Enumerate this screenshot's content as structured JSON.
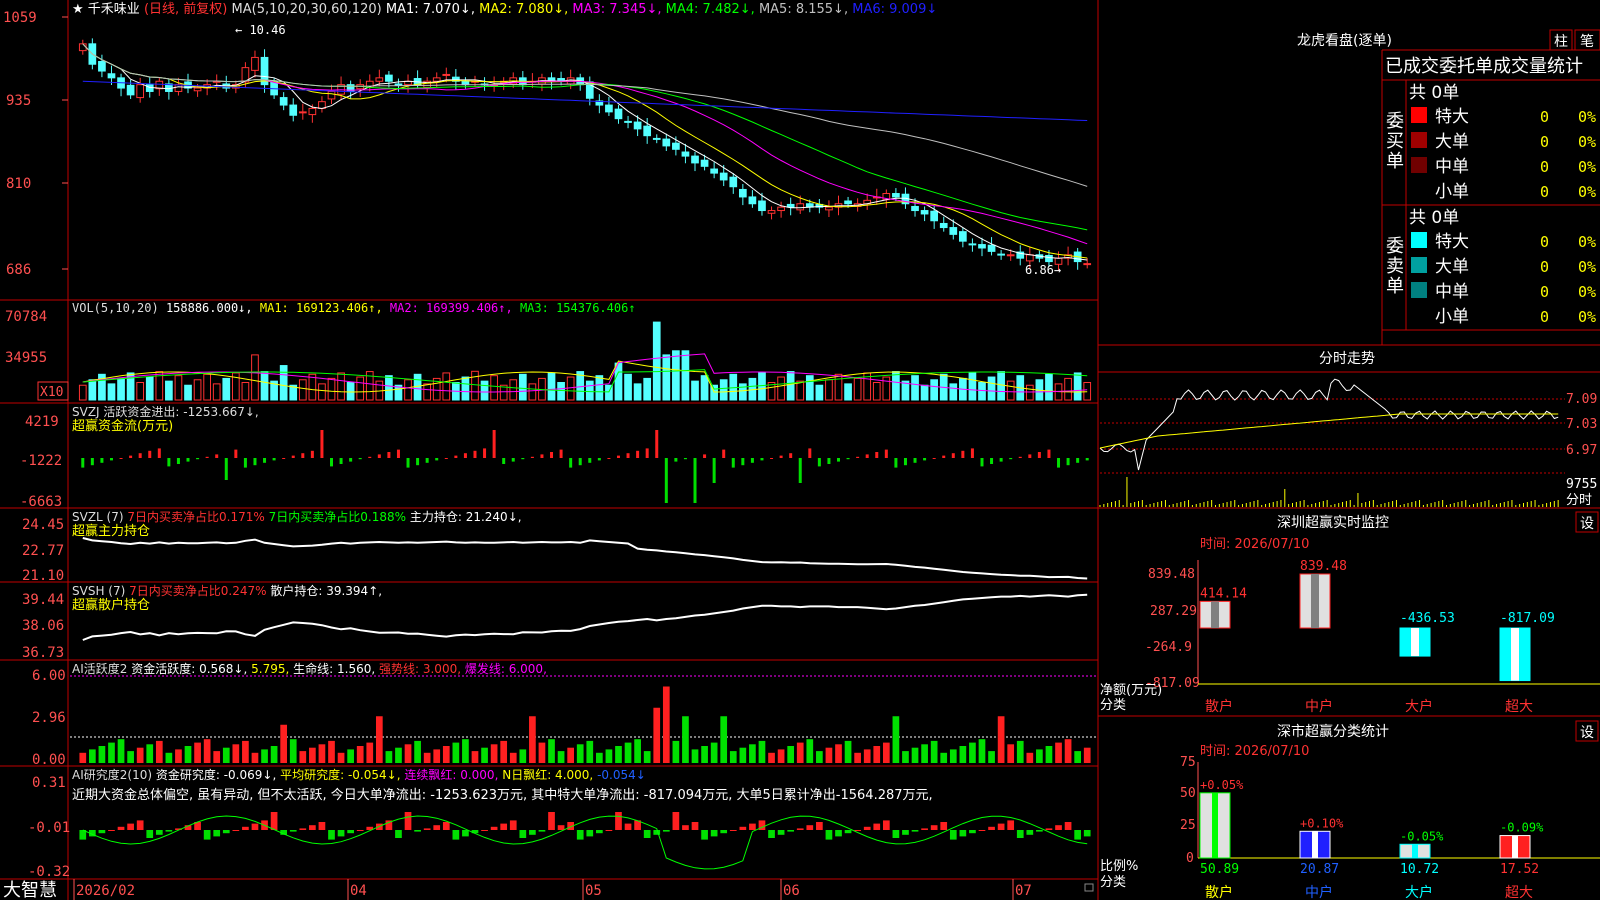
{
  "header": {
    "star": "★",
    "stock_name": "千禾味业",
    "period": "(日线, 前复权)",
    "ma_label": "MA(5,10,20,30,60,120)",
    "ma_values": [
      {
        "text": "MA1: 7.070↓,",
        "color": "#ffffff"
      },
      {
        "text": "MA2: 7.080↓,",
        "color": "#ffff00"
      },
      {
        "text": "MA3: 7.345↓,",
        "color": "#ff00ff"
      },
      {
        "text": "MA4: 7.482↓,",
        "color": "#00ff00"
      },
      {
        "text": "MA5: 8.155↓,",
        "color": "#c0c0c0"
      },
      {
        "text": "MA6: 9.009↓",
        "color": "#2020ff"
      }
    ],
    "high_marker": "10.46",
    "low_marker": "6.86"
  },
  "price_axis": [
    "1059",
    "935",
    "810",
    "686"
  ],
  "vol_panel": {
    "label": "VOL(5,10,20)",
    "values": [
      {
        "text": "158886.000↓,",
        "color": "#ffffff"
      },
      {
        "text": "MA1: 169123.406↑,",
        "color": "#ffff00"
      },
      {
        "text": "MA2: 169399.406↑,",
        "color": "#ff00ff"
      },
      {
        "text": "MA3: 154376.406↑",
        "color": "#00ff00"
      }
    ],
    "axis": [
      "70784",
      "34955"
    ],
    "unit_badge": "X10"
  },
  "svzj_panel": {
    "label": "SVZJ  活跃资金进出: -1253.667↓,",
    "sublabel": "超赢资金流(万元)",
    "axis": [
      "4219",
      "-1222",
      "-6663"
    ]
  },
  "svzl_panel": {
    "label": "SVZL (7)",
    "part2": "7日内买卖净占比0.171%",
    "part3": "7日内买卖净占比0.188%",
    "part4": "主力持仓: 21.240↓,",
    "sublabel": "超赢主力持仓",
    "axis": [
      "24.45",
      "22.77",
      "21.10"
    ]
  },
  "svsh_panel": {
    "label": "SVSH (7)",
    "part2": "7日内买卖净占比0.247%",
    "part3": "散户持仓: 39.394↑,",
    "sublabel": "超赢散户持仓",
    "axis": [
      "39.44",
      "38.06",
      "36.73"
    ]
  },
  "ai_active_panel": {
    "label": "AI活跃度2",
    "part2": "资金活跃度: 0.568↓,",
    "part3": "5.795,",
    "part4": "生命线: 1.560,",
    "part5": "强势线: 3.000,",
    "part6": "爆发线: 6.000,",
    "axis": [
      "6.00",
      "2.96",
      "0.00"
    ]
  },
  "ai_research_panel": {
    "label": "AI研究度2(10)",
    "part2": "资金研究度: -0.069↓,",
    "part3": "平均研究度: -0.054↓,",
    "part4": "连续飘红: 0.000,",
    "part5": "N日飘红: 4.000,",
    "part6": "-0.054↓",
    "summary": "近期大资金总体偏空, 虽有异动, 但不太活跃, 今日大单净流出: -1253.623万元, 其中特大单净流出: -817.094万元, 大单5日累计净出-1564.287万元, ",
    "axis": [
      "0.31",
      "-0.01",
      "-0.32"
    ]
  },
  "date_axis": {
    "brand": "大智慧",
    "labels": [
      "2026/02",
      "04",
      "05",
      "06",
      "07"
    ]
  },
  "right_panel": {
    "title": "龙虎看盘(逐单)",
    "btn_zhu": "柱",
    "btn_bi": "笔",
    "header_text": "已成交委托单成交量统计",
    "buy_label": "委买单",
    "sell_label": "委卖单",
    "buy_total": "共 0单",
    "sell_total": "共 0单",
    "buy_rows": [
      {
        "name": "特大",
        "count": "0",
        "pct": "0%",
        "color": "#ff0000"
      },
      {
        "name": "大单",
        "count": "0",
        "pct": "0%",
        "color": "#a00000"
      },
      {
        "name": "中单",
        "count": "0",
        "pct": "0%",
        "color": "#700000"
      },
      {
        "name": "小单",
        "count": "0",
        "pct": "0%",
        "color": ""
      }
    ],
    "sell_rows": [
      {
        "name": "特大",
        "count": "0",
        "pct": "0%",
        "color": "#00ffff"
      },
      {
        "name": "大单",
        "count": "0",
        "pct": "0%",
        "color": "#00a0a0"
      },
      {
        "name": "中单",
        "count": "0",
        "pct": "0%",
        "color": "#008080"
      },
      {
        "name": "小单",
        "count": "0",
        "pct": "0%",
        "color": ""
      }
    ],
    "intraday_title": "分时走势",
    "intraday_axis": [
      "7.09",
      "7.03",
      "6.97",
      "9755"
    ],
    "intraday_unit": "分时",
    "sz_monitor": {
      "title": "深圳超赢实时监控",
      "settings": "设",
      "date_label": "时间: 2026/07/10",
      "axis": [
        "839.48",
        "287.29",
        "-264.9",
        "-817.09"
      ],
      "y_label": "净额(万元)",
      "x_label": "分类",
      "categories": [
        "散户",
        "中户",
        "大户",
        "超大"
      ],
      "values": [
        414.14,
        839.48,
        -436.53,
        -817.09
      ],
      "value_labels": [
        "414.14",
        "839.48",
        "-436.53",
        "-817.09"
      ]
    },
    "sz_class": {
      "title": "深市超赢分类统计",
      "settings": "设",
      "date_label": "时间: 2026/07/10",
      "axis": [
        "75",
        "50",
        "25",
        "0"
      ],
      "y_label": "比例%",
      "x_label": "分类",
      "categories": [
        "散户",
        "中户",
        "大户",
        "超大"
      ],
      "values": [
        50.89,
        20.87,
        10.72,
        17.52
      ],
      "changes": [
        "+0.05%",
        "+0.10%",
        "-0.05%",
        "-0.09%"
      ]
    }
  },
  "colors": {
    "up": "#ff3232",
    "down": "#54ffff",
    "grid": "#c00000",
    "axis_text": "#ff5050"
  },
  "chart_data": {
    "type": "candlestick",
    "title": "千禾味业 (日线, 前复权)",
    "x_labels": [
      "2026/02",
      "04",
      "05",
      "06",
      "07"
    ],
    "price_range": [
      6.86,
      10.46
    ],
    "close_approx": [
      10.3,
      10.0,
      9.9,
      9.8,
      9.65,
      9.55,
      9.7,
      9.6,
      9.75,
      9.6,
      9.7,
      9.65,
      9.65,
      9.7,
      9.75,
      9.65,
      9.7,
      9.95,
      10.1,
      9.7,
      9.55,
      9.4,
      9.25,
      9.3,
      9.35,
      9.45,
      9.6,
      9.7,
      9.6,
      9.7,
      9.75,
      9.8,
      9.75,
      9.7,
      9.75,
      9.7,
      9.75,
      9.8,
      9.85,
      9.75,
      9.7,
      9.75,
      9.7,
      9.7,
      9.75,
      9.8,
      9.7,
      9.75,
      9.8,
      9.75,
      9.75,
      9.8,
      9.7,
      9.5,
      9.4,
      9.3,
      9.2,
      9.15,
      9.05,
      8.95,
      8.9,
      8.8,
      8.75,
      8.65,
      8.55,
      8.5,
      8.4,
      8.3,
      8.2,
      8.05,
      7.95,
      7.85,
      7.85,
      7.9,
      7.9,
      7.95,
      7.9,
      7.9,
      7.9,
      7.95,
      7.95,
      7.95,
      8.0,
      8.05,
      8.1,
      8.05,
      7.95,
      7.85,
      7.8,
      7.7,
      7.6,
      7.5,
      7.4,
      7.35,
      7.3,
      7.25,
      7.2,
      7.2,
      7.15,
      7.2,
      7.15,
      7.1,
      7.15,
      7.2,
      7.1,
      7.07
    ]
  }
}
